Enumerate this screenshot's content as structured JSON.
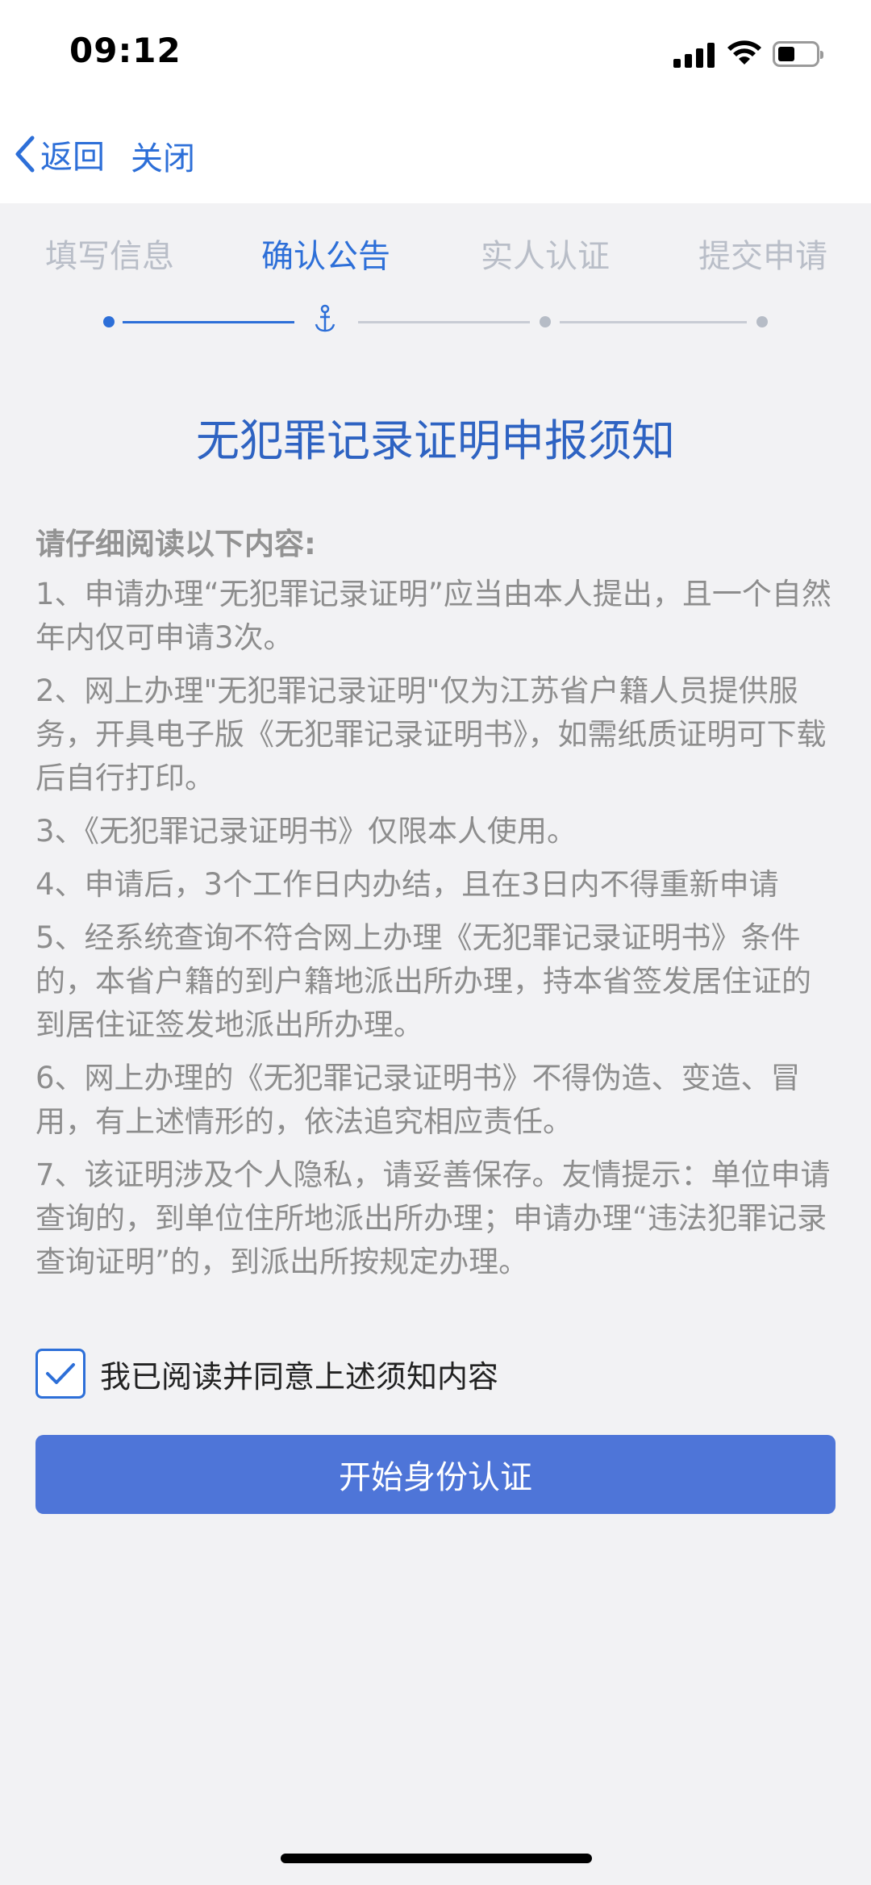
{
  "status_bar": {
    "time": "09:12"
  },
  "nav": {
    "back_label": "返回",
    "close_label": "关闭"
  },
  "steps": [
    {
      "label": "填写信息",
      "state": "done"
    },
    {
      "label": "确认公告",
      "state": "current"
    },
    {
      "label": "实人认证",
      "state": "pending"
    },
    {
      "label": "提交申请",
      "state": "pending"
    }
  ],
  "notice": {
    "title": "无犯罪记录证明申报须知",
    "intro": "请仔细阅读以下内容:",
    "items": [
      "1、申请办理“无犯罪记录证明”应当由本人提出，且一个自然年内仅可申请3次。",
      "2、网上办理\"无犯罪记录证明\"仅为江苏省户籍人员提供服务，开具电子版《无犯罪记录证明书》，如需纸质证明可下载后自行打印。",
      "3、《无犯罪记录证明书》仅限本人使用。",
      "4、申请后，3个工作日内办结，且在3日内不得重新申请",
      "5、经系统查询不符合网上办理《无犯罪记录证明书》条件的，本省户籍的到户籍地派出所办理，持本省签发居住证的到居住证签发地派出所办理。",
      "6、网上办理的《无犯罪记录证明书》不得伪造、变造、冒用，有上述情形的，依法追究相应责任。",
      "7、该证明涉及个人隐私，请妥善保存。友情提示：单位申请查询的，到单位住所地派出所办理；申请办理“违法犯罪记录查询证明”的，到派出所按规定办理。"
    ]
  },
  "agreement": {
    "checked": true,
    "label": "我已阅读并同意上述须知内容"
  },
  "primary_button": {
    "label": "开始身份认证"
  },
  "colors": {
    "accent": "#2d6fd8",
    "title": "#2e63c2",
    "button": "#4e75d8",
    "background": "#f2f2f4",
    "body_text": "#8d8d8d",
    "inactive_step": "#b9bec8"
  }
}
